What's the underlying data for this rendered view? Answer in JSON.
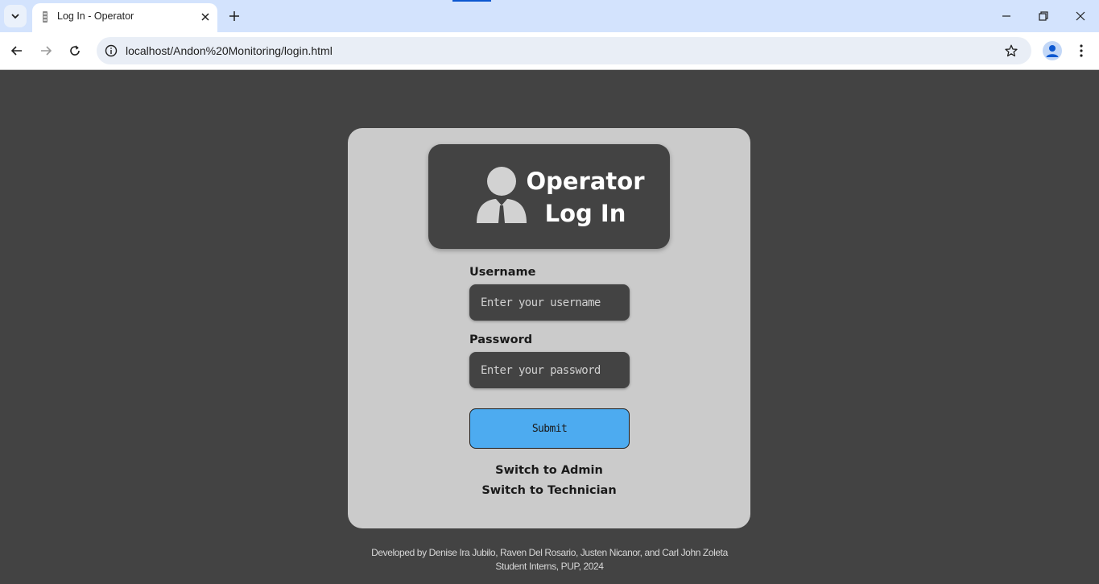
{
  "browser": {
    "tab_title": "Log In - Operator",
    "url": "localhost/Andon%20Monitoring/login.html"
  },
  "login": {
    "title_line1": "Operator",
    "title_line2": "Log In",
    "username_label": "Username",
    "username_placeholder": "Enter your username",
    "password_label": "Password",
    "password_placeholder": "Enter your password",
    "submit_label": "Submit",
    "switch_admin": "Switch to Admin",
    "switch_technician": "Switch to Technician"
  },
  "footer": {
    "line1": "Developed by Denise Ira Jubilo, Raven Del Rosario, Justen Nicanor, and Carl John Zoleta",
    "line2": "Student Interns, PUP, 2024"
  },
  "colors": {
    "page_background": "#434343",
    "card_background": "#cbcbcb",
    "submit_button": "#4dabf0"
  }
}
